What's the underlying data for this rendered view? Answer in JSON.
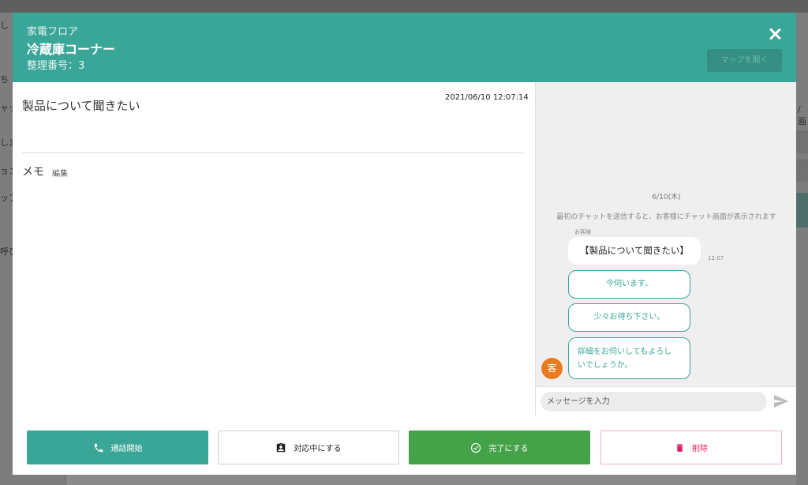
{
  "background": {
    "side_items": [
      "し",
      "ち",
      "ャッ",
      "しま",
      "ョン",
      "ップ",
      "呼び"
    ],
    "right_text": "/画"
  },
  "header": {
    "floor": "家電フロア",
    "corner": "冷蔵庫コーナー",
    "number": "整理番号：3",
    "map_button": "マップを開く",
    "color": "#3aa697"
  },
  "detail": {
    "subject": "製品について聞きたい",
    "timestamp": "2021/06/10 12:07:14",
    "memo_label": "メモ",
    "memo_edit": "編集"
  },
  "chat": {
    "date": "6/10(木)",
    "notice": "最初のチャットを送信すると、お客様にチャット画面が表示されます",
    "sender": "お客様",
    "customer_message": "【製品について聞きたい】",
    "message_time": "12:07",
    "replies": [
      "今伺います。",
      "少々お待ち下さい。",
      "詳細をお伺いしてもよろしいでしょうか。"
    ],
    "reply_line1": "詳細をお伺いしてもよろし",
    "reply_line2": "いでしょうか。",
    "avatar": "客",
    "input_placeholder": "メッセージを入力",
    "avatar_color": "#ea7b1f"
  },
  "footer": {
    "call": "通話開始",
    "handle": "対応中にする",
    "done": "完了にする",
    "delete": "削除",
    "colors": {
      "call": "#3aa697",
      "done": "#44a249",
      "delete": "#e21b6a"
    }
  },
  "icons": {
    "close": "close-icon",
    "send": "send-icon",
    "phone": "phone-icon",
    "badge": "assignment-ind-icon",
    "check": "check-circle-icon",
    "trash": "trash-icon"
  }
}
